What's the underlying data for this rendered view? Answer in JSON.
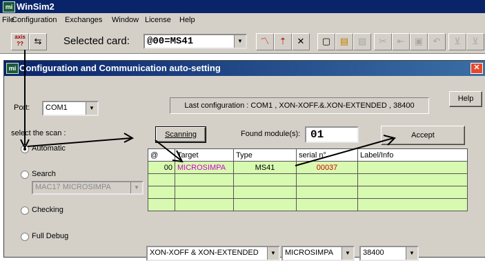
{
  "app": {
    "title": "WinSim2",
    "icon_text": "mi"
  },
  "menu": [
    "File",
    "Configuration",
    "Exchanges",
    "Window",
    "License",
    "Help"
  ],
  "toolbar": {
    "left_btn1": "axis ??",
    "selected_card_label": "Selected card:",
    "selected_card_value": "@00=MS41"
  },
  "dialog": {
    "title": "Configuration and Communication auto-setting",
    "help_label": "Help",
    "port_label": "Port:",
    "port_value": "COM1",
    "last_config": "Last configuration : COM1 , XON-XOFF.&.XON-EXTENDED , 38400",
    "scan_label": "select the scan :",
    "scanning_label": "Scanning",
    "found_label": "Found module(s):",
    "found_count": "01",
    "accept_label": "Accept",
    "options": {
      "automatic": "Automatic",
      "search": "Search",
      "search_value": "MAC17 MICROSIMPA",
      "checking": "Checking",
      "full_debug": "Full Debug"
    },
    "table": {
      "headers": [
        "@",
        "Target",
        "Type",
        "serial n°",
        "Label/Info"
      ],
      "rows": [
        [
          "00",
          "MICROSIMPA",
          "MS41",
          "00037",
          ""
        ],
        [
          "",
          "",
          "",
          "",
          ""
        ],
        [
          "",
          "",
          "",
          "",
          ""
        ],
        [
          "",
          "",
          "",
          "",
          ""
        ]
      ]
    },
    "bottom": {
      "protocol": "XON-XOFF & XON-EXTENDED",
      "device": "MICROSIMPA",
      "baud": "38400"
    }
  },
  "colors": {
    "title_bar": "#0a246a",
    "grid_bg": "#d8f9b0",
    "target_text": "#d400d4",
    "serial_text": "#d40000"
  }
}
